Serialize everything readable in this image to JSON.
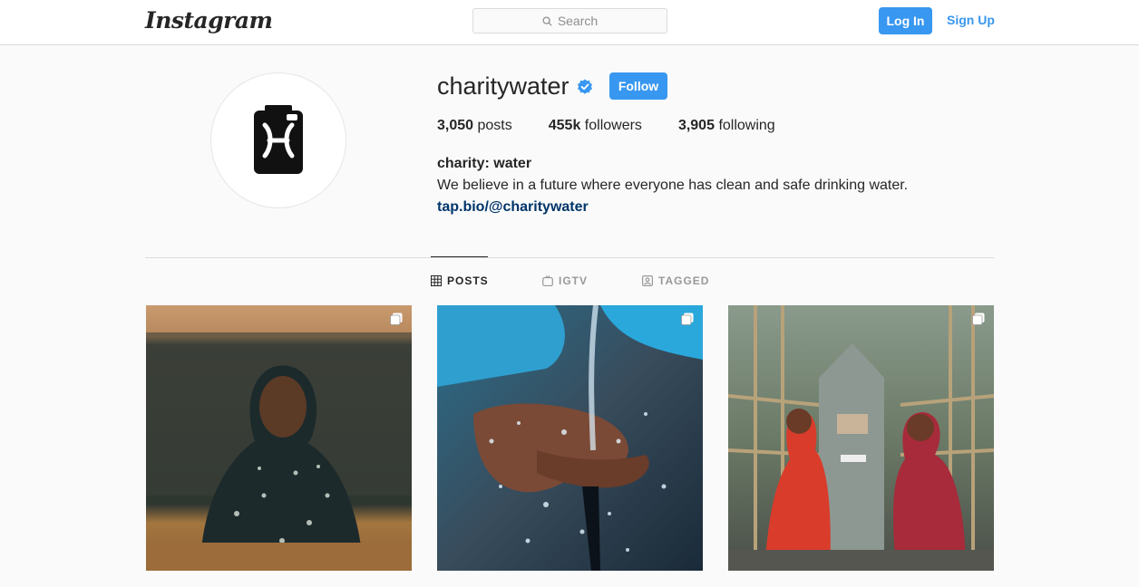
{
  "nav": {
    "logo": "Instagram",
    "search_placeholder": "Search",
    "login_label": "Log In",
    "signup_label": "Sign Up"
  },
  "profile": {
    "username": "charitywater",
    "verified": true,
    "follow_label": "Follow",
    "stats": [
      {
        "value": "3,050",
        "label": "posts"
      },
      {
        "value": "455k",
        "label": "followers"
      },
      {
        "value": "3,905",
        "label": "following"
      }
    ],
    "full_name": "charity: water",
    "bio": "We believe in a future where everyone has clean and safe drinking water.",
    "link": "tap.bio/@charitywater"
  },
  "tabs": [
    {
      "label": "POSTS",
      "icon": "grid-icon",
      "active": true
    },
    {
      "label": "IGTV",
      "icon": "tv-icon",
      "active": false
    },
    {
      "label": "TAGGED",
      "icon": "tag-icon",
      "active": false
    }
  ],
  "posts": [
    {
      "id": "post-1",
      "multiple": true
    },
    {
      "id": "post-2",
      "multiple": true
    },
    {
      "id": "post-3",
      "multiple": true
    }
  ],
  "colors": {
    "accent": "#3897f0",
    "link": "#003569",
    "border": "#dbdbdb",
    "background": "#fafafa"
  }
}
